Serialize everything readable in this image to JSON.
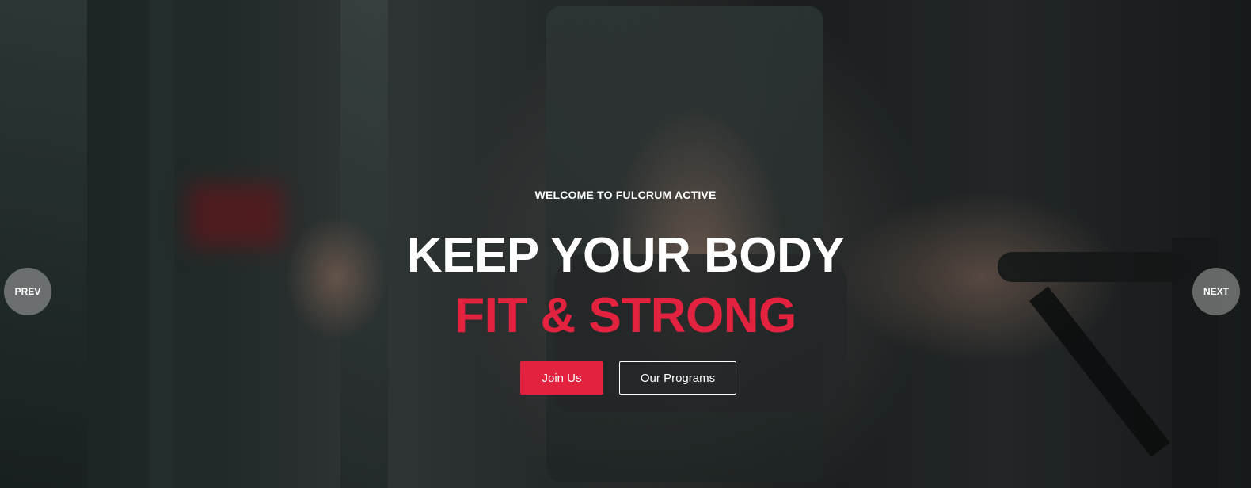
{
  "hero": {
    "eyebrow": "WELCOME TO FULCRUM ACTIVE",
    "headline": "KEEP YOUR BODY",
    "headline_accent": "FIT & STRONG",
    "accent_color": "#e2223e"
  },
  "cta": {
    "primary_label": "Join Us",
    "secondary_label": "Our Programs"
  },
  "slider": {
    "prev_label": "PREV",
    "next_label": "NEXT"
  }
}
